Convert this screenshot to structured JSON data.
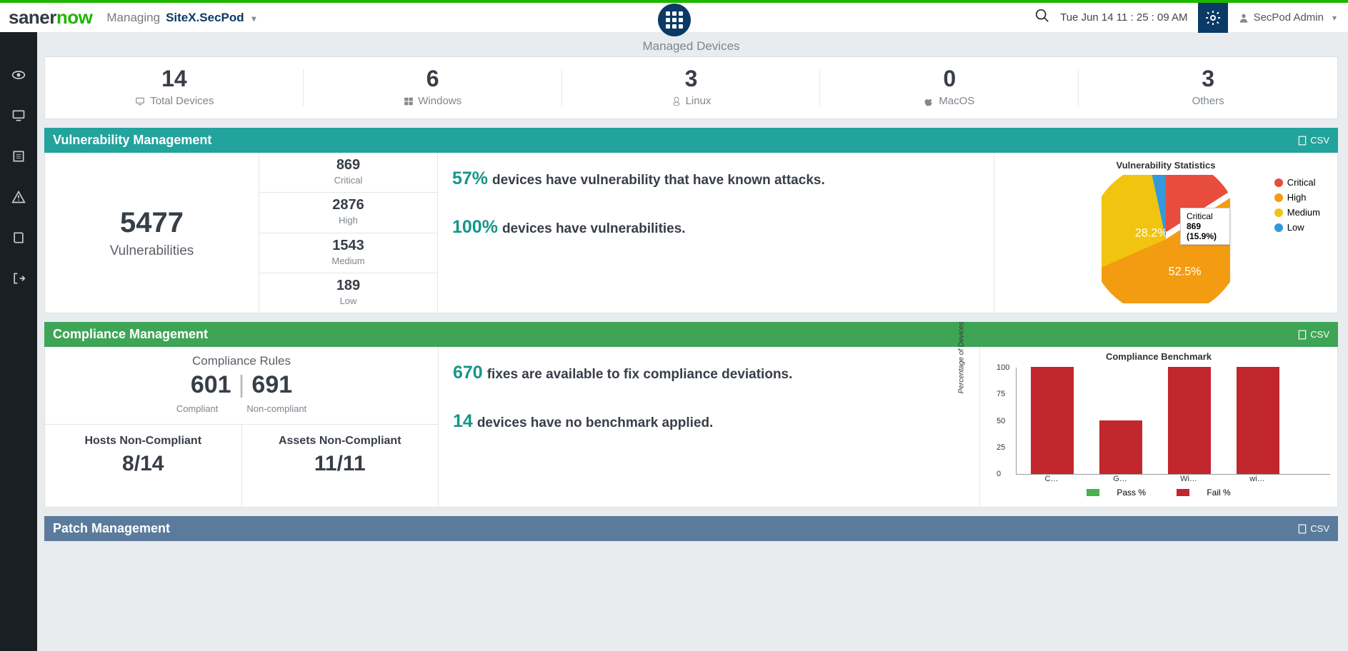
{
  "logo": {
    "p1": "saner",
    "p2": "now"
  },
  "header": {
    "managing_label": "Managing",
    "site": "SiteX.SecPod",
    "datetime": "Tue Jun 14  11 : 25 : 09 AM",
    "user": "SecPod Admin"
  },
  "managed_devices": {
    "title": "Managed Devices",
    "items": [
      {
        "n": "14",
        "label": "Total Devices"
      },
      {
        "n": "6",
        "label": "Windows"
      },
      {
        "n": "3",
        "label": "Linux"
      },
      {
        "n": "0",
        "label": "MacOS"
      },
      {
        "n": "3",
        "label": "Others"
      }
    ]
  },
  "csv_label": "CSV",
  "vuln": {
    "title": "Vulnerability Management",
    "total_n": "5477",
    "total_label": "Vulnerabilities",
    "sev": [
      {
        "n": "869",
        "label": "Critical"
      },
      {
        "n": "2876",
        "label": "High"
      },
      {
        "n": "1543",
        "label": "Medium"
      },
      {
        "n": "189",
        "label": "Low"
      }
    ],
    "stmt1_pct": "57%",
    "stmt1_txt": "devices have vulnerability that have known attacks.",
    "stmt2_pct": "100%",
    "stmt2_txt": "devices have vulnerabilities.",
    "chart_title": "Vulnerability Statistics",
    "legend": [
      "Critical",
      "High",
      "Medium",
      "Low"
    ],
    "colors": {
      "Critical": "#e74c3c",
      "High": "#f39c12",
      "Medium": "#f1c40f",
      "Low": "#3498db"
    },
    "pie_label": "28.2%",
    "pie_label2": "52.5%",
    "tooltip_line1": "Critical",
    "tooltip_line2": "869 (15.9%)"
  },
  "comp": {
    "title": "Compliance Management",
    "rules_hdr": "Compliance Rules",
    "compliant_n": "601",
    "noncompliant_n": "691",
    "compliant_lbl": "Compliant",
    "noncompliant_lbl": "Non-compliant",
    "hosts_lbl": "Hosts Non-Compliant",
    "hosts_n": "8/14",
    "assets_lbl": "Assets Non-Compliant",
    "assets_n": "11/11",
    "stmt1_pct": "670",
    "stmt1_txt": "fixes are available to fix compliance deviations.",
    "stmt2_pct": "14",
    "stmt2_txt": "devices have no benchmark applied.",
    "chart_title": "Compliance Benchmark",
    "ylabel": "Percentage of Devices",
    "legend_pass": "Pass %",
    "legend_fail": "Fail %"
  },
  "patch": {
    "title": "Patch Management"
  },
  "chart_data": [
    {
      "type": "pie",
      "title": "Vulnerability Statistics",
      "series": [
        {
          "name": "Critical",
          "value": 869,
          "pct": 15.9,
          "color": "#e74c3c"
        },
        {
          "name": "High",
          "value": 2876,
          "pct": 52.5,
          "color": "#f39c12"
        },
        {
          "name": "Medium",
          "value": 1543,
          "pct": 28.2,
          "color": "#f1c40f"
        },
        {
          "name": "Low",
          "value": 189,
          "pct": 3.4,
          "color": "#3498db"
        }
      ],
      "highlight": "Critical"
    },
    {
      "type": "bar",
      "title": "Compliance Benchmark",
      "ylabel": "Percentage of Devices",
      "ylim": [
        0,
        100
      ],
      "categories": [
        "C…",
        "G…",
        "Wi…",
        "wi…"
      ],
      "series": [
        {
          "name": "Pass %",
          "color": "#4caf50",
          "values": [
            0,
            0,
            0,
            0
          ]
        },
        {
          "name": "Fail %",
          "color": "#c1272d",
          "values": [
            100,
            50,
            100,
            100
          ]
        }
      ]
    }
  ]
}
